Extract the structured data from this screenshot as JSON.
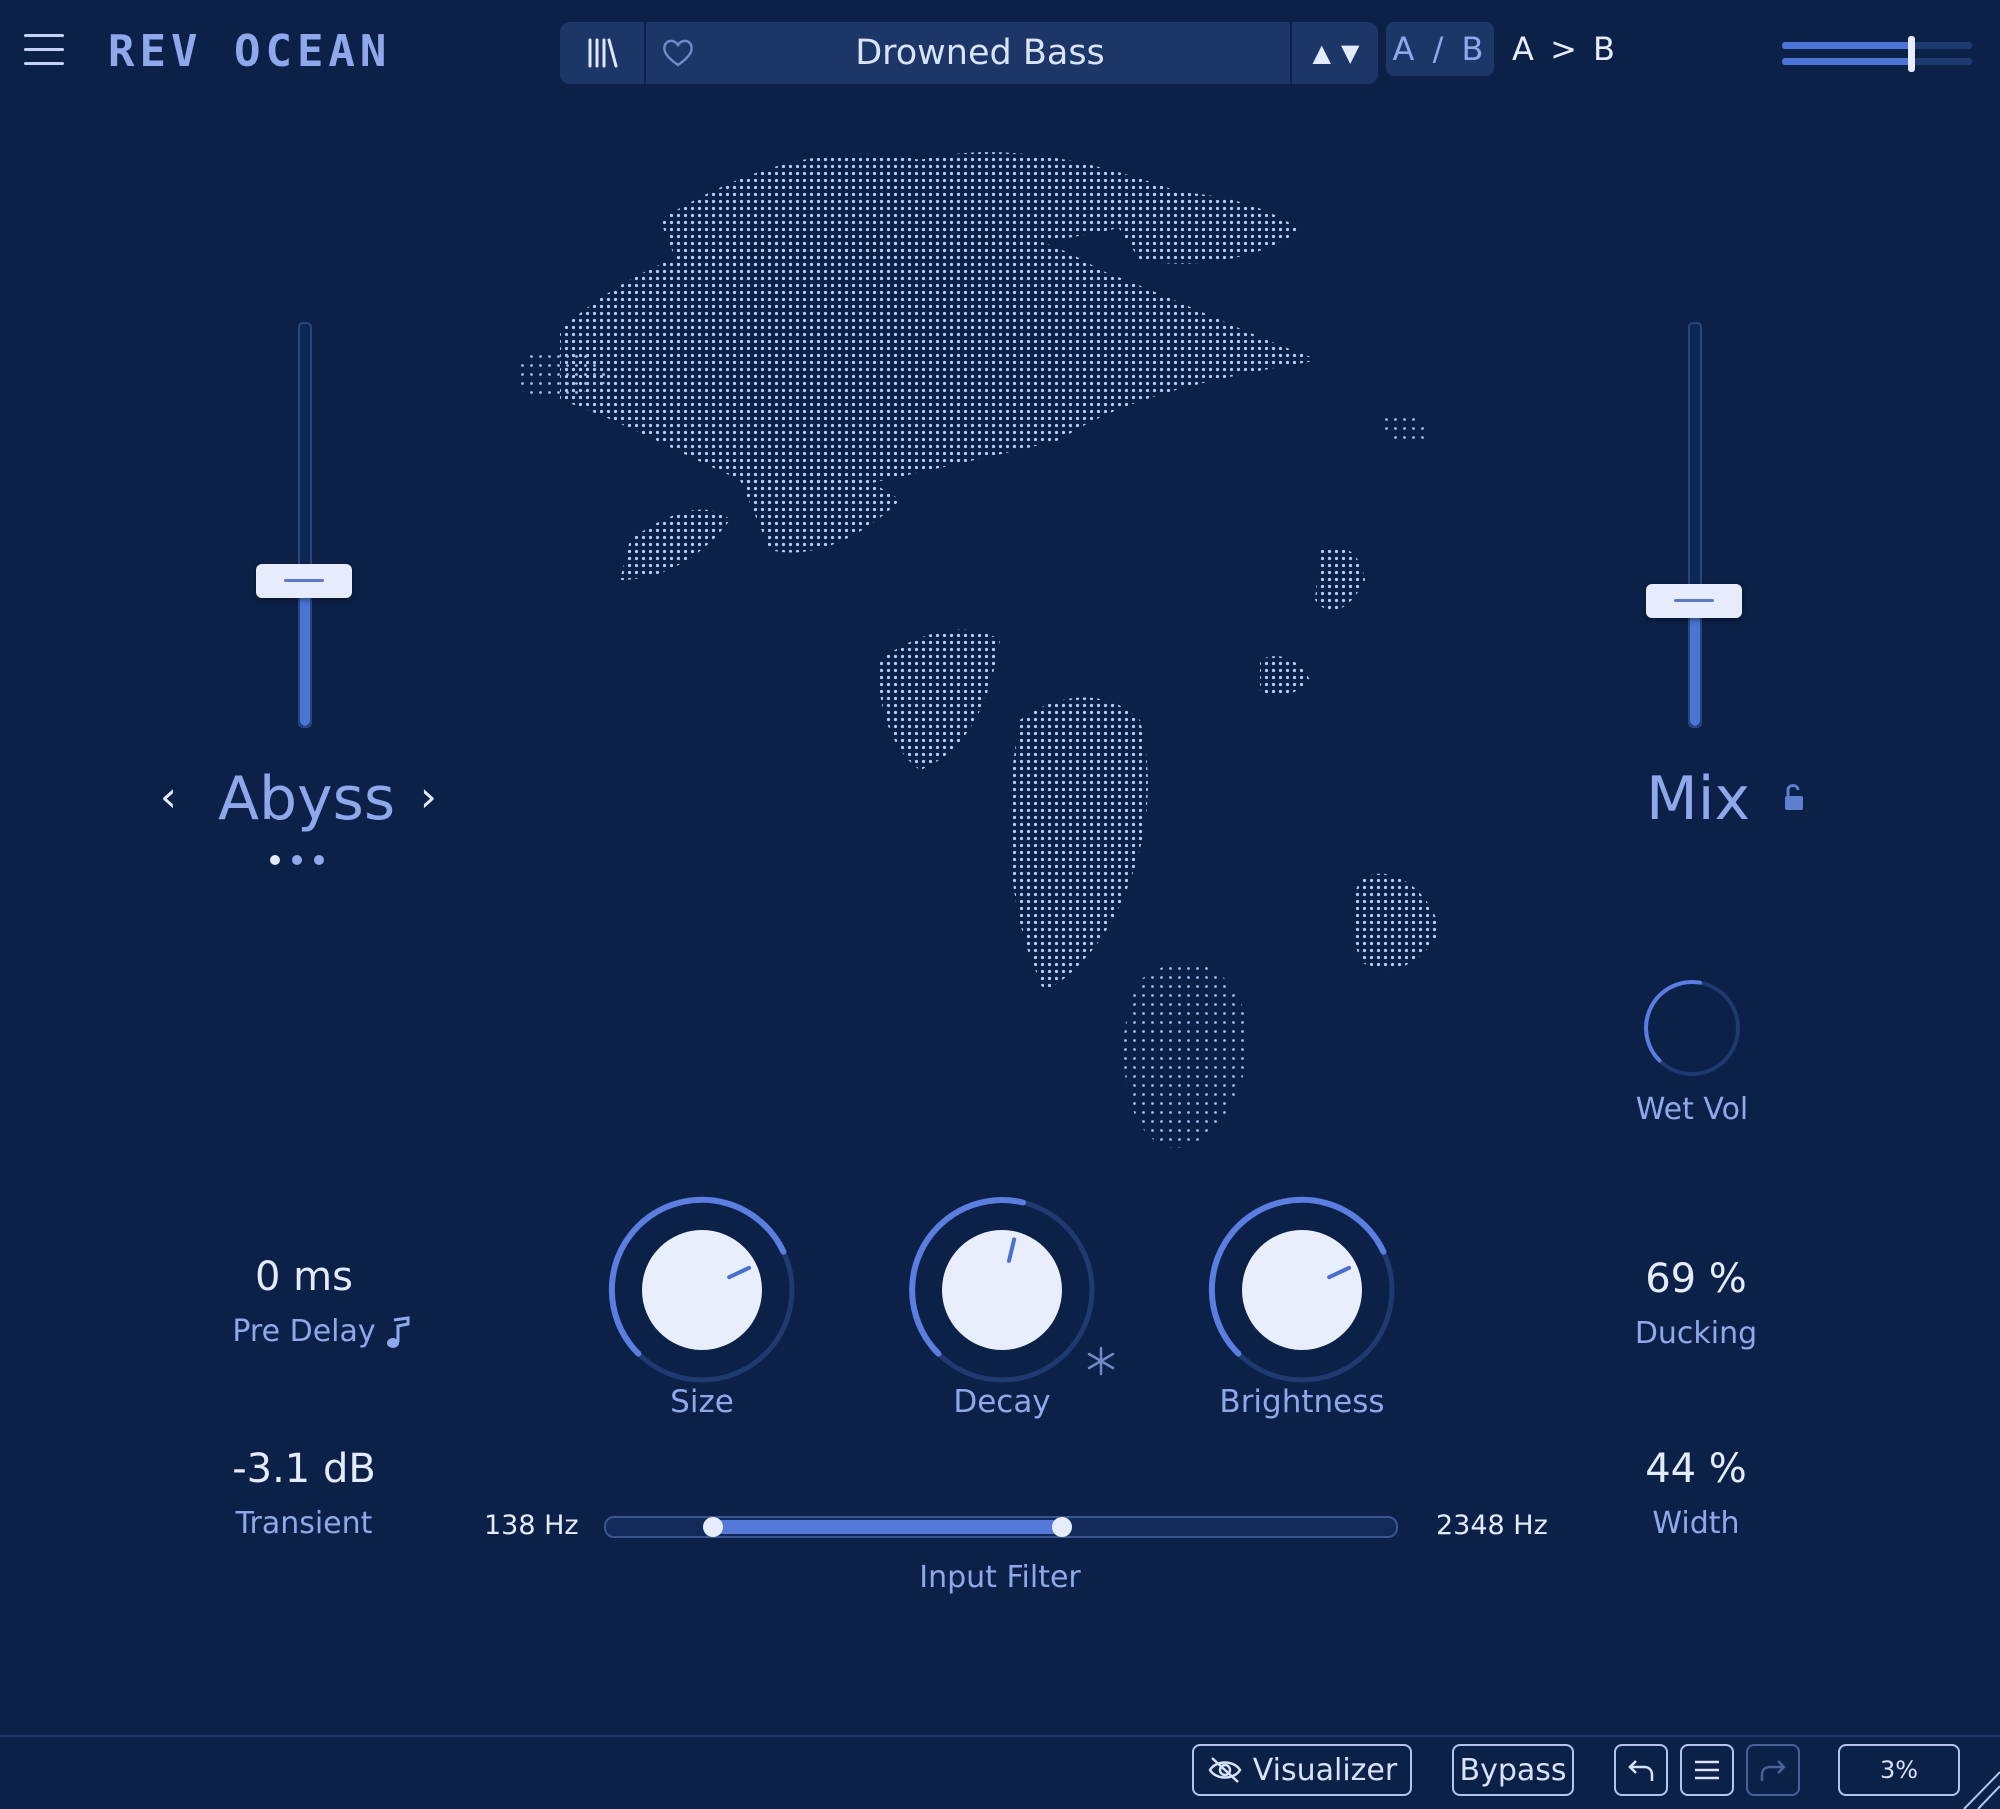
{
  "header": {
    "logo": "REV OCEAN",
    "preset_name": "Drowned Bass",
    "ab_toggle": "A / B",
    "ab_copy": "A > B"
  },
  "left": {
    "character_label": "Abyss",
    "character_fader_level": 0.36,
    "pre_delay": {
      "value": "0 ms",
      "label": "Pre Delay"
    },
    "transient": {
      "value": "-3.1 dB",
      "label": "Transient"
    }
  },
  "right": {
    "mix_label": "Mix",
    "mix_fader_level": 0.31,
    "wet_vol": {
      "label": "Wet Vol",
      "level": 0.5
    },
    "ducking": {
      "value": "69 %",
      "label": "Ducking"
    },
    "width": {
      "value": "44 %",
      "label": "Width"
    }
  },
  "knobs": {
    "size": {
      "label": "Size",
      "level": 0.74
    },
    "decay": {
      "label": "Decay",
      "level": 0.55
    },
    "brightness": {
      "label": "Brightness",
      "level": 0.74
    }
  },
  "input_filter": {
    "label": "Input Filter",
    "low": "138 Hz",
    "high": "2348 Hz",
    "low_level": 0.135,
    "high_level": 0.577
  },
  "footer": {
    "visualizer": "Visualizer",
    "bypass": "Bypass",
    "zoom": "3%"
  },
  "colors": {
    "background": "#0c2148",
    "accent": "#4a74d6",
    "text_light": "#e4ebfd",
    "text_muted": "#8fa8ec"
  },
  "icons": [
    "hamburger-icon",
    "library-icon",
    "heart-icon",
    "up-arrow-icon",
    "down-arrow-icon",
    "lock-icon",
    "music-note-icon",
    "snowflake-icon",
    "eye-off-icon",
    "undo-icon",
    "list-icon",
    "redo-icon",
    "resize-grip-icon"
  ]
}
